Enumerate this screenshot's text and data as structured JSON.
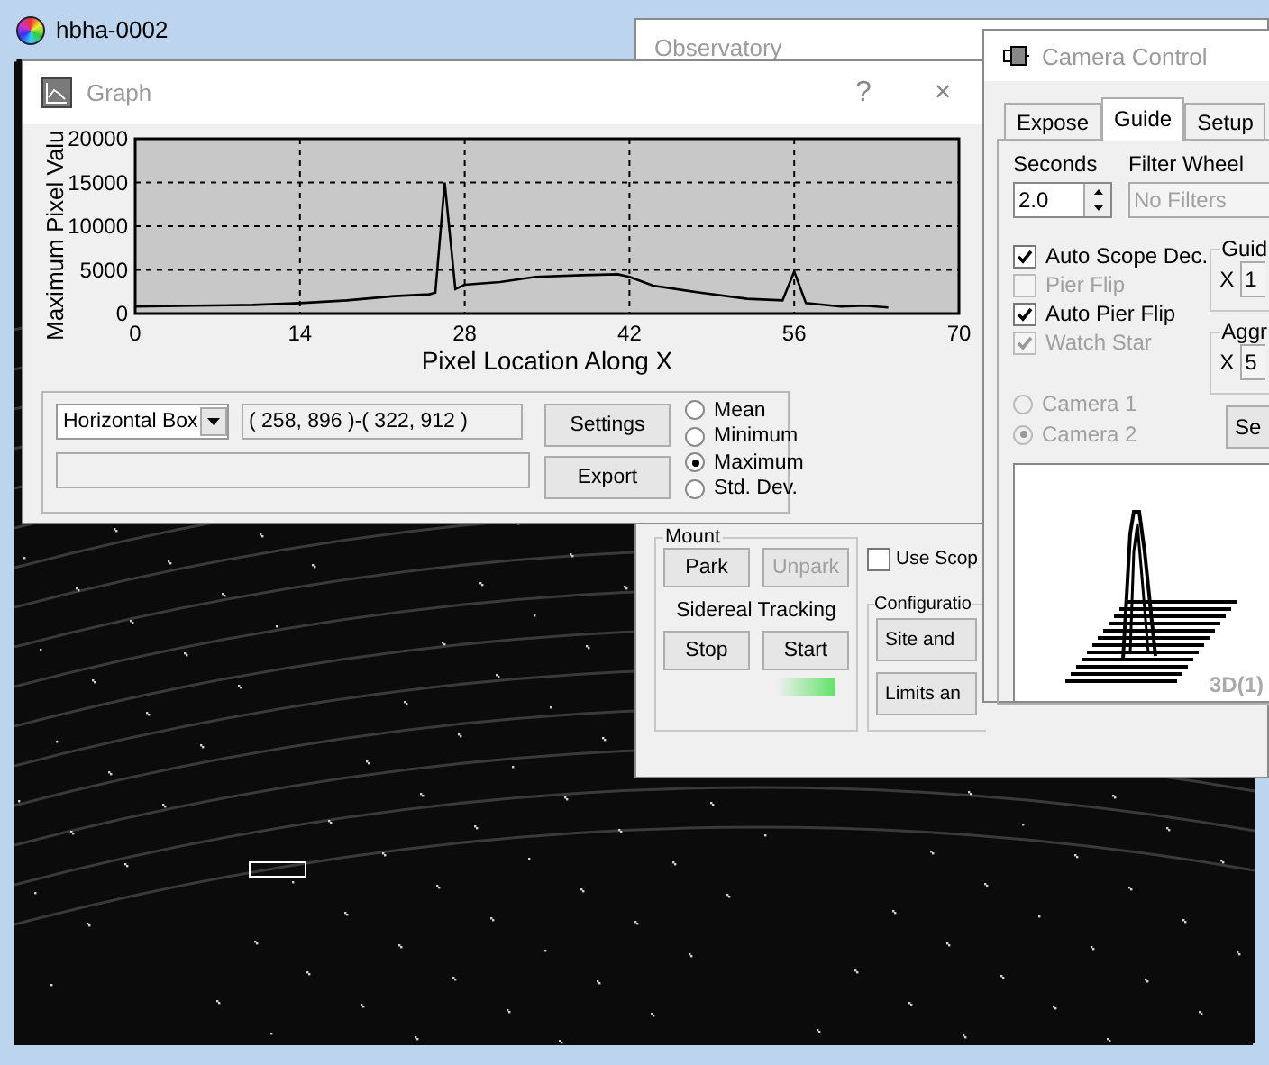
{
  "image_window": {
    "title": "hbha-0002"
  },
  "graph_window": {
    "title": "Graph",
    "help": "?",
    "close": "×",
    "chart_data": {
      "type": "line",
      "grid": true,
      "xlabel": "Pixel Location Along X",
      "ylabel": "Maximum Pixel Valu",
      "xlim": [
        0,
        70
      ],
      "ylim": [
        0,
        20000
      ],
      "xticks": [
        0,
        14,
        28,
        42,
        56,
        70
      ],
      "yticks": [
        0,
        5000,
        10000,
        15000,
        20000
      ],
      "x": [
        0,
        5,
        10,
        14,
        18,
        22,
        25,
        25.5,
        26.3,
        27.2,
        28,
        31,
        34,
        38,
        41,
        42,
        44,
        48,
        52,
        55,
        56,
        57,
        60,
        62,
        64
      ],
      "series": [
        {
          "color": "#000000",
          "values": [
            800,
            900,
            1000,
            1200,
            1500,
            2000,
            2200,
            2400,
            15000,
            2800,
            3300,
            3600,
            4200,
            4400,
            4500,
            4200,
            3200,
            2400,
            1700,
            1500,
            4800,
            1200,
            800,
            900,
            700
          ]
        }
      ]
    },
    "shape_select": "Horizontal Box",
    "coords": "( 258, 896 )-( 322, 912 )",
    "buttons": [
      "Settings",
      "Export"
    ],
    "statistics": [
      {
        "label": "Mean",
        "selected": false
      },
      {
        "label": "Minimum",
        "selected": false
      },
      {
        "label": "Maximum",
        "selected": true
      },
      {
        "label": "Std. Dev.",
        "selected": false
      }
    ]
  },
  "observatory_window": {
    "title": "Observatory",
    "mount": {
      "title": "Mount",
      "park_buttons": [
        {
          "label": "Park",
          "disabled": false
        },
        {
          "label": "Unpark",
          "disabled": true
        }
      ],
      "tracking_label": "Sidereal Tracking",
      "tracking_buttons": [
        {
          "label": "Stop",
          "disabled": false
        },
        {
          "label": "Start",
          "disabled": false
        }
      ],
      "tracking_indicator": {
        "on": true
      }
    },
    "use_scope": {
      "label": "Use Scop",
      "checked": false
    },
    "configuration": {
      "title": "Configuratio",
      "buttons": [
        "Site and",
        "Limits an"
      ]
    }
  },
  "camera_window": {
    "title": "Camera Control",
    "tabs": [
      {
        "label": "Expose",
        "selected": false
      },
      {
        "label": "Guide",
        "selected": true
      },
      {
        "label": "Setup",
        "selected": false
      }
    ],
    "seconds": {
      "label": "Seconds",
      "value": "2.0"
    },
    "filter_wheel": {
      "label": "Filter Wheel",
      "value": "No Filters",
      "disabled": true
    },
    "options": [
      {
        "label": "Auto Scope Dec.",
        "checked": true,
        "disabled": false
      },
      {
        "label": "Pier Flip",
        "checked": false,
        "disabled": true
      },
      {
        "label": "Auto Pier Flip",
        "checked": true,
        "disabled": false
      },
      {
        "label": "Watch Star",
        "checked": true,
        "disabled": true
      }
    ],
    "groups": [
      {
        "title": "Guid",
        "axis": "X",
        "value": "1"
      },
      {
        "title": "Aggr",
        "axis": "X",
        "value": "5"
      }
    ],
    "cameras": [
      {
        "label": "Camera 1",
        "selected": false,
        "disabled": true
      },
      {
        "label": "Camera 2",
        "selected": true,
        "disabled": true
      }
    ],
    "button": "Se",
    "plot_label": "3D(1)"
  }
}
